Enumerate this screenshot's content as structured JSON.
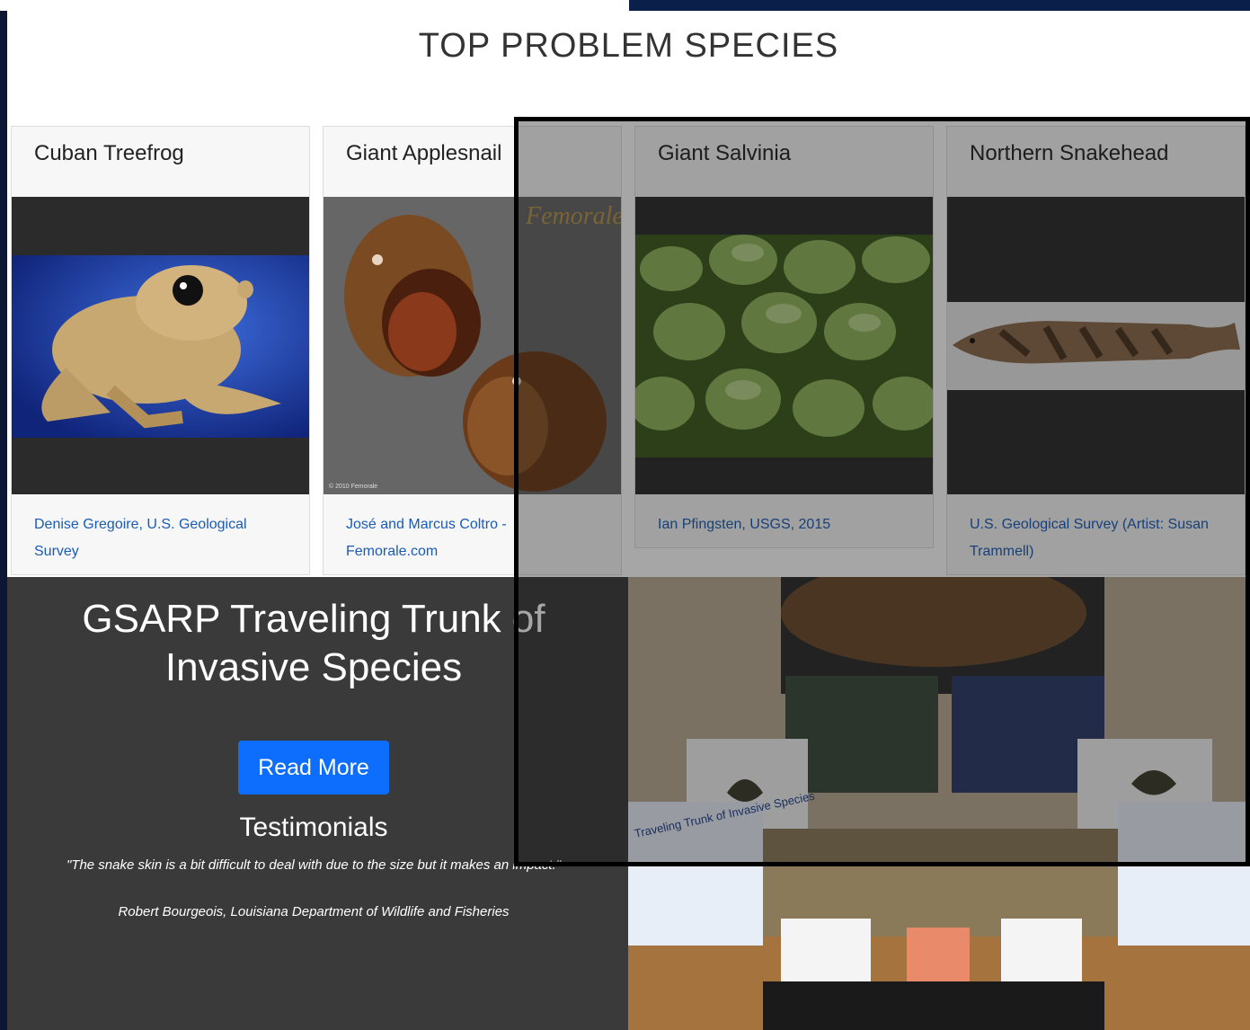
{
  "page": {
    "title": "TOP PROBLEM SPECIES"
  },
  "cards": [
    {
      "name": "Cuban Treefrog",
      "credit": "Denise Gregoire, U.S. Geological Survey"
    },
    {
      "name": "Giant Applesnail",
      "credit": "José and Marcus Coltro - Femorale.com",
      "watermark": "Femorale",
      "copyright": "© 2010 Femorale"
    },
    {
      "name": "Giant Salvinia",
      "credit": "Ian Pfingsten, USGS, 2015"
    },
    {
      "name": "Northern Snakehead",
      "credit": "U.S. Geological Survey (Artist: Susan Trammell)"
    }
  ],
  "hero": {
    "heading_line1": "GSARP Traveling Trunk of",
    "heading_line2": "Invasive Species",
    "read_more_label": "Read More"
  },
  "testimonials": {
    "heading": "Testimonials",
    "quote": "\"The snake skin is a bit difficult to deal with due to the size but it makes an impact.\"",
    "author": "Robert Bourgeois, Louisiana Department of Wildlife and Fisheries"
  },
  "trunk_photo": {
    "binder_text": "Traveling Trunk of Invasive Species"
  },
  "colors": {
    "accent": "#0d6efd",
    "link": "#1a5bb5",
    "dark_bg": "#3a3a3a"
  }
}
